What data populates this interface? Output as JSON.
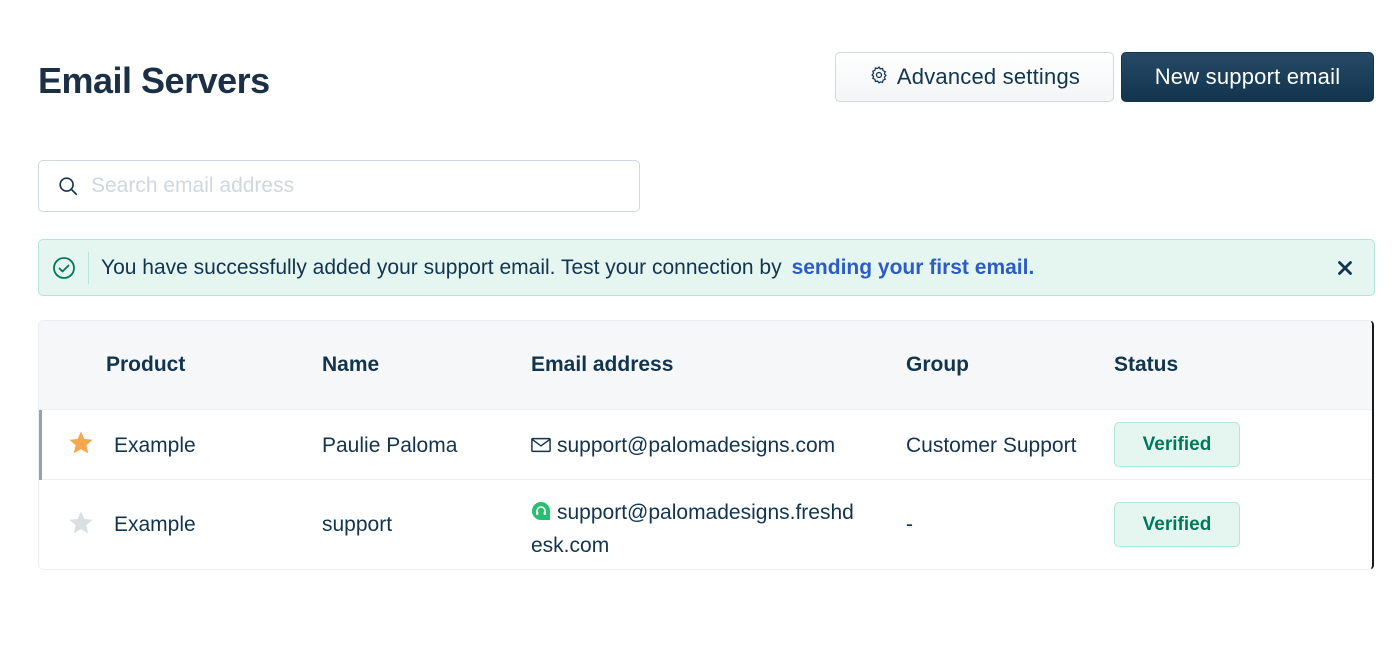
{
  "header": {
    "title": "Email Servers",
    "advanced_settings_label": "Advanced settings",
    "new_support_email_label": "New support email"
  },
  "search": {
    "placeholder": "Search email address",
    "value": ""
  },
  "alert": {
    "message": "You have successfully added your support email. Test your connection by",
    "link_text": "sending your first email.",
    "close_icon": "close-icon",
    "status_icon": "check-circle-icon"
  },
  "table": {
    "columns": [
      "Product",
      "Name",
      "Email address",
      "Group",
      "Status"
    ],
    "rows": [
      {
        "starred": true,
        "product": "Example",
        "name": "Paulie Paloma",
        "email_icon": "envelope-icon",
        "email": "support@palomadesigns.com",
        "group": "Customer Support",
        "status": "Verified"
      },
      {
        "starred": false,
        "product": "Example",
        "name": "support",
        "email_icon": "freshdesk-icon",
        "email_line1": "support@palomadesigns.freshd",
        "email_line2": "esk.com",
        "group": "-",
        "status": "Verified"
      }
    ]
  },
  "colors": {
    "primary": "#12344d",
    "link": "#2c5cc5",
    "success_bg": "#e5f5f0",
    "success_text": "#00795b",
    "star_active": "#f4a74c",
    "star_inactive": "#dadfe3"
  }
}
